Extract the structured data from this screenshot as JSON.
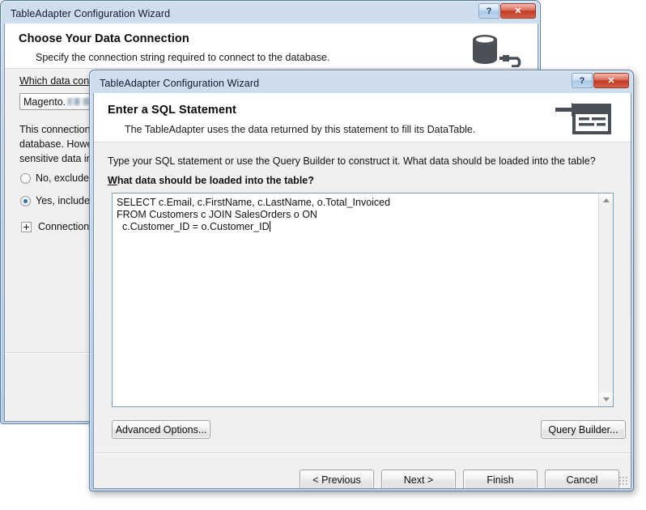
{
  "background_window": {
    "title": "TableAdapter Configuration Wizard",
    "caption_buttons": {
      "help": "?",
      "close": "✕"
    },
    "header": {
      "title": "Choose Your Data Connection",
      "subtitle": "Specify the connection string required to connect to the database.",
      "icon": "database-icon"
    },
    "connection_label": "Which data conn",
    "connection_value": "Magento.",
    "body_text_line1": "This connection",
    "body_text_line2": "database. Howev",
    "body_text_line3": "sensitive data in",
    "radio_no": "No, exclude s",
    "radio_yes": "Yes, include s",
    "expander_label": "Connection"
  },
  "foreground_window": {
    "title": "TableAdapter Configuration Wizard",
    "caption_buttons": {
      "help": "?",
      "close": "✕"
    },
    "header": {
      "title": "Enter a SQL Statement",
      "subtitle": "The TableAdapter uses the data returned by this statement to fill its DataTable.",
      "icon": "sql-statement-icon"
    },
    "instruction": "Type your SQL statement or use the Query Builder to construct it. What data should be loaded into the table?",
    "field_label_prefix": "W",
    "field_label_rest": "hat data should be loaded into the table?",
    "sql_text": "SELECT c.Email, c.FirstName, c.LastName, o.Total_Invoiced\nFROM Customers c JOIN SalesOrders o ON\n  c.Customer_ID = o.Customer_ID",
    "scrollbar": {
      "up": "scroll-up-arrow",
      "down": "scroll-down-arrow"
    },
    "buttons": {
      "advanced_options": {
        "prefix": "A",
        "accel": "",
        "label": "dvanced Options..."
      },
      "query_builder": {
        "label": "uery Builder..."
      },
      "previous": {
        "label": "revious"
      },
      "next": {
        "label": "ext >"
      },
      "finish": {
        "label": "inish"
      },
      "cancel": {
        "label": "Cancel"
      }
    },
    "button_labels": {
      "advanced_options": "Advanced Options...",
      "query_builder": "Query Builder...",
      "previous": "< Previous",
      "next": "Next >",
      "finish": "Finish",
      "cancel": "Cancel"
    }
  },
  "colors": {
    "titlebar_gradient_top": "#cfdeef",
    "titlebar_gradient_bottom": "#b2c8e2",
    "close_button_red": "#c03a22",
    "dialog_face": "#f0f0f0",
    "header_white": "#ffffff",
    "icon_gray": "#4a4f55",
    "radio_dot_blue": "#2a6fc4",
    "text_primary": "#111111"
  }
}
